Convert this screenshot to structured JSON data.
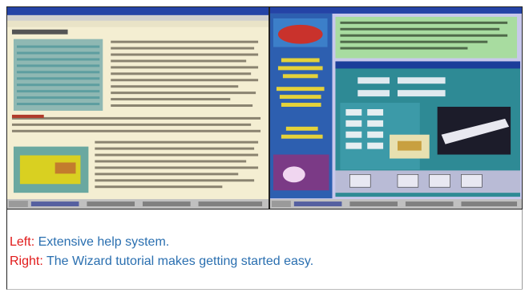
{
  "captions": {
    "left_label": "Left:",
    "left_text": " Extensive help system.",
    "right_label": "Right:",
    "right_text": " The Wizard tutorial makes getting started easy."
  },
  "images": {
    "left": "help-system-screenshot",
    "right": "wizard-tutorial-screenshot"
  },
  "colors": {
    "label": "#e11b1b",
    "text": "#2a6fb0",
    "help_bg": "#f6f0d1",
    "wizard_bg": "#1f5fa8"
  }
}
